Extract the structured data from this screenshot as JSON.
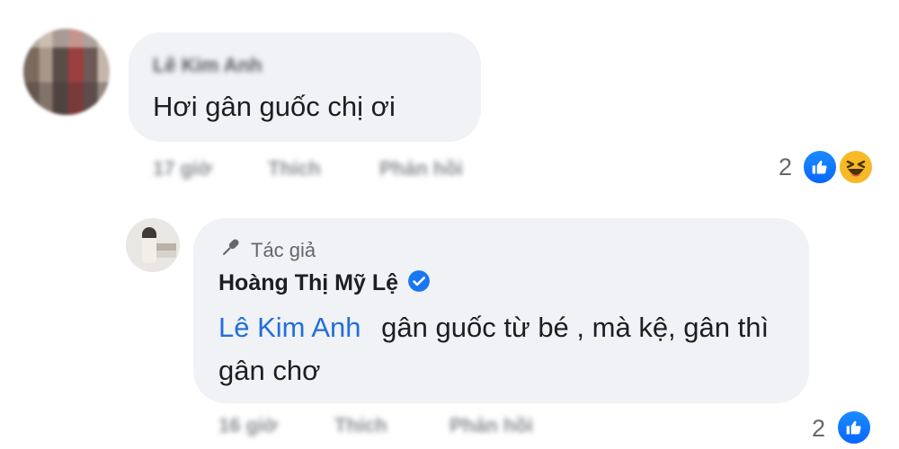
{
  "comment": {
    "author_name": "Lê Kim Anh",
    "text": "Hơi gân guốc chị ơi",
    "meta": {
      "time": "17 giờ",
      "like_label": "Thích",
      "reply_label": "Phản hồi"
    },
    "reaction_count": "2",
    "reactions": [
      "like-icon",
      "haha-icon"
    ]
  },
  "reply": {
    "author_badge_label": "Tác giả",
    "author_name": "Hoàng Thị Mỹ Lệ",
    "mention": "Lê Kim Anh",
    "text": "gân guốc từ bé , mà kệ, gân thì gân chơ",
    "meta": {
      "time": "16 giờ",
      "like_label": "Thích",
      "reply_label": "Phản hồi"
    },
    "reaction_count": "2",
    "reactions": [
      "like-icon"
    ]
  },
  "colors": {
    "bubble": "#f0f2f5",
    "mention": "#216fdb",
    "like": "#0866ff",
    "verified": "#1877f2",
    "haha": "#f7b928"
  }
}
